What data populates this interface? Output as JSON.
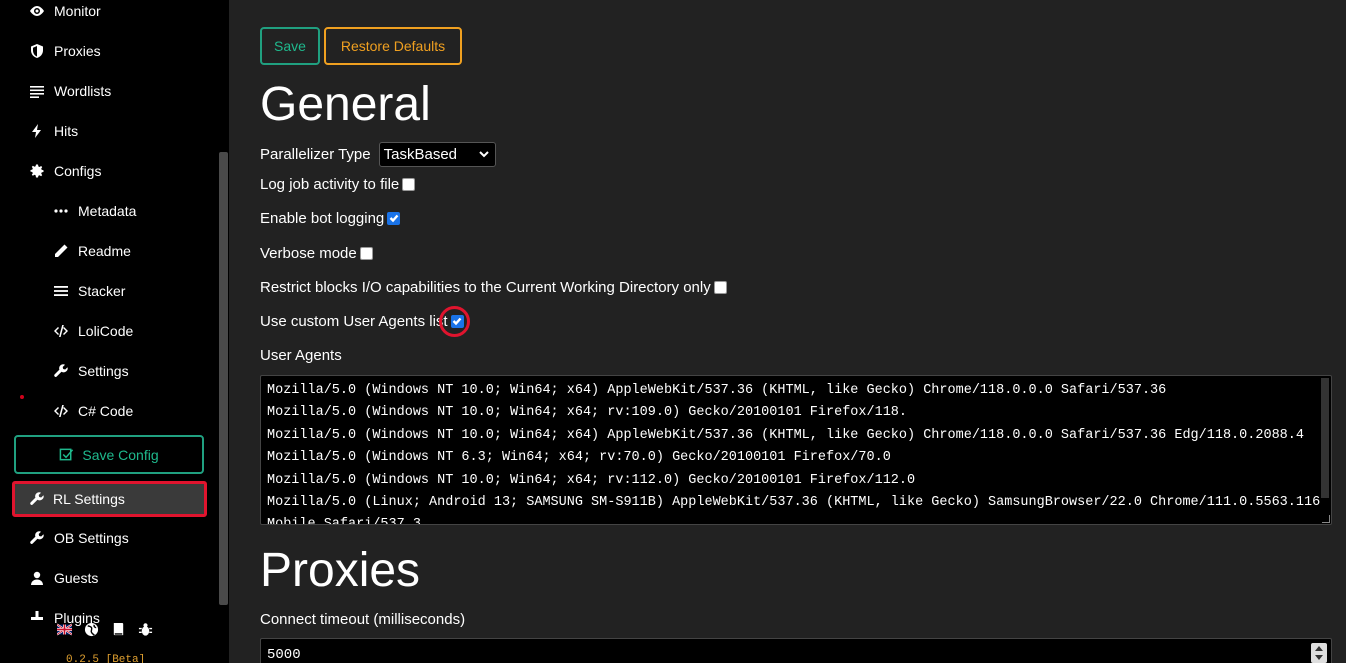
{
  "sidebar": {
    "items": [
      {
        "label": "Monitor",
        "icon": "eye-icon"
      },
      {
        "label": "Proxies",
        "icon": "shield-icon"
      },
      {
        "label": "Wordlists",
        "icon": "list-icon"
      },
      {
        "label": "Hits",
        "icon": "bolt-icon"
      },
      {
        "label": "Configs",
        "icon": "gear-icon"
      },
      {
        "label": "Metadata",
        "icon": "dots-icon"
      },
      {
        "label": "Readme",
        "icon": "pencil-icon"
      },
      {
        "label": "Stacker",
        "icon": "hamburger-icon"
      },
      {
        "label": "LoliCode",
        "icon": "code-icon"
      },
      {
        "label": "Settings",
        "icon": "wrench-icon"
      },
      {
        "label": "C# Code",
        "icon": "code-icon"
      }
    ],
    "save_config": "Save Config",
    "rl_settings": "RL Settings",
    "ob_settings": "OB Settings",
    "guests": "Guests",
    "plugins": "Plugins",
    "version": "0.2.5 [Beta]"
  },
  "toolbar": {
    "save": "Save",
    "restore": "Restore Defaults"
  },
  "general": {
    "title": "General",
    "parallelizer_label": "Parallelizer Type",
    "parallelizer_value": "TaskBased",
    "log_job_activity": "Log job activity to file",
    "log_job_activity_checked": false,
    "enable_bot_logging": "Enable bot logging",
    "enable_bot_logging_checked": true,
    "verbose_mode": "Verbose mode",
    "verbose_mode_checked": false,
    "restrict_io": "Restrict blocks I/O capabilities to the Current Working Directory only",
    "restrict_io_checked": false,
    "custom_ua": "Use custom User Agents list",
    "custom_ua_checked": true,
    "user_agents_label": "User Agents",
    "user_agents": [
      "Mozilla/5.0 (Windows NT 10.0; Win64; x64) AppleWebKit/537.36 (KHTML, like Gecko) Chrome/118.0.0.0 Safari/537.36",
      "Mozilla/5.0 (Windows NT 10.0; Win64; x64; rv:109.0) Gecko/20100101 Firefox/118.",
      "Mozilla/5.0 (Windows NT 10.0; Win64; x64) AppleWebKit/537.36 (KHTML, like Gecko) Chrome/118.0.0.0 Safari/537.36 Edg/118.0.2088.4",
      "Mozilla/5.0 (Windows NT 6.3; Win64; x64; rv:70.0) Gecko/20100101 Firefox/70.0",
      "Mozilla/5.0 (Windows NT 10.0; Win64; x64; rv:112.0) Gecko/20100101 Firefox/112.0",
      "Mozilla/5.0 (Linux; Android 13; SAMSUNG SM-S911B) AppleWebKit/537.36 (KHTML, like Gecko) SamsungBrowser/22.0 Chrome/111.0.5563.116",
      "Mobile Safari/537.3"
    ]
  },
  "proxies": {
    "title": "Proxies",
    "connect_timeout_label": "Connect timeout (milliseconds)",
    "connect_timeout_value": "5000"
  },
  "colors": {
    "accent_green": "#1fb98d",
    "accent_orange": "#f0a020",
    "highlight_red": "#e0142e",
    "checkbox_blue": "#1a73e8"
  }
}
